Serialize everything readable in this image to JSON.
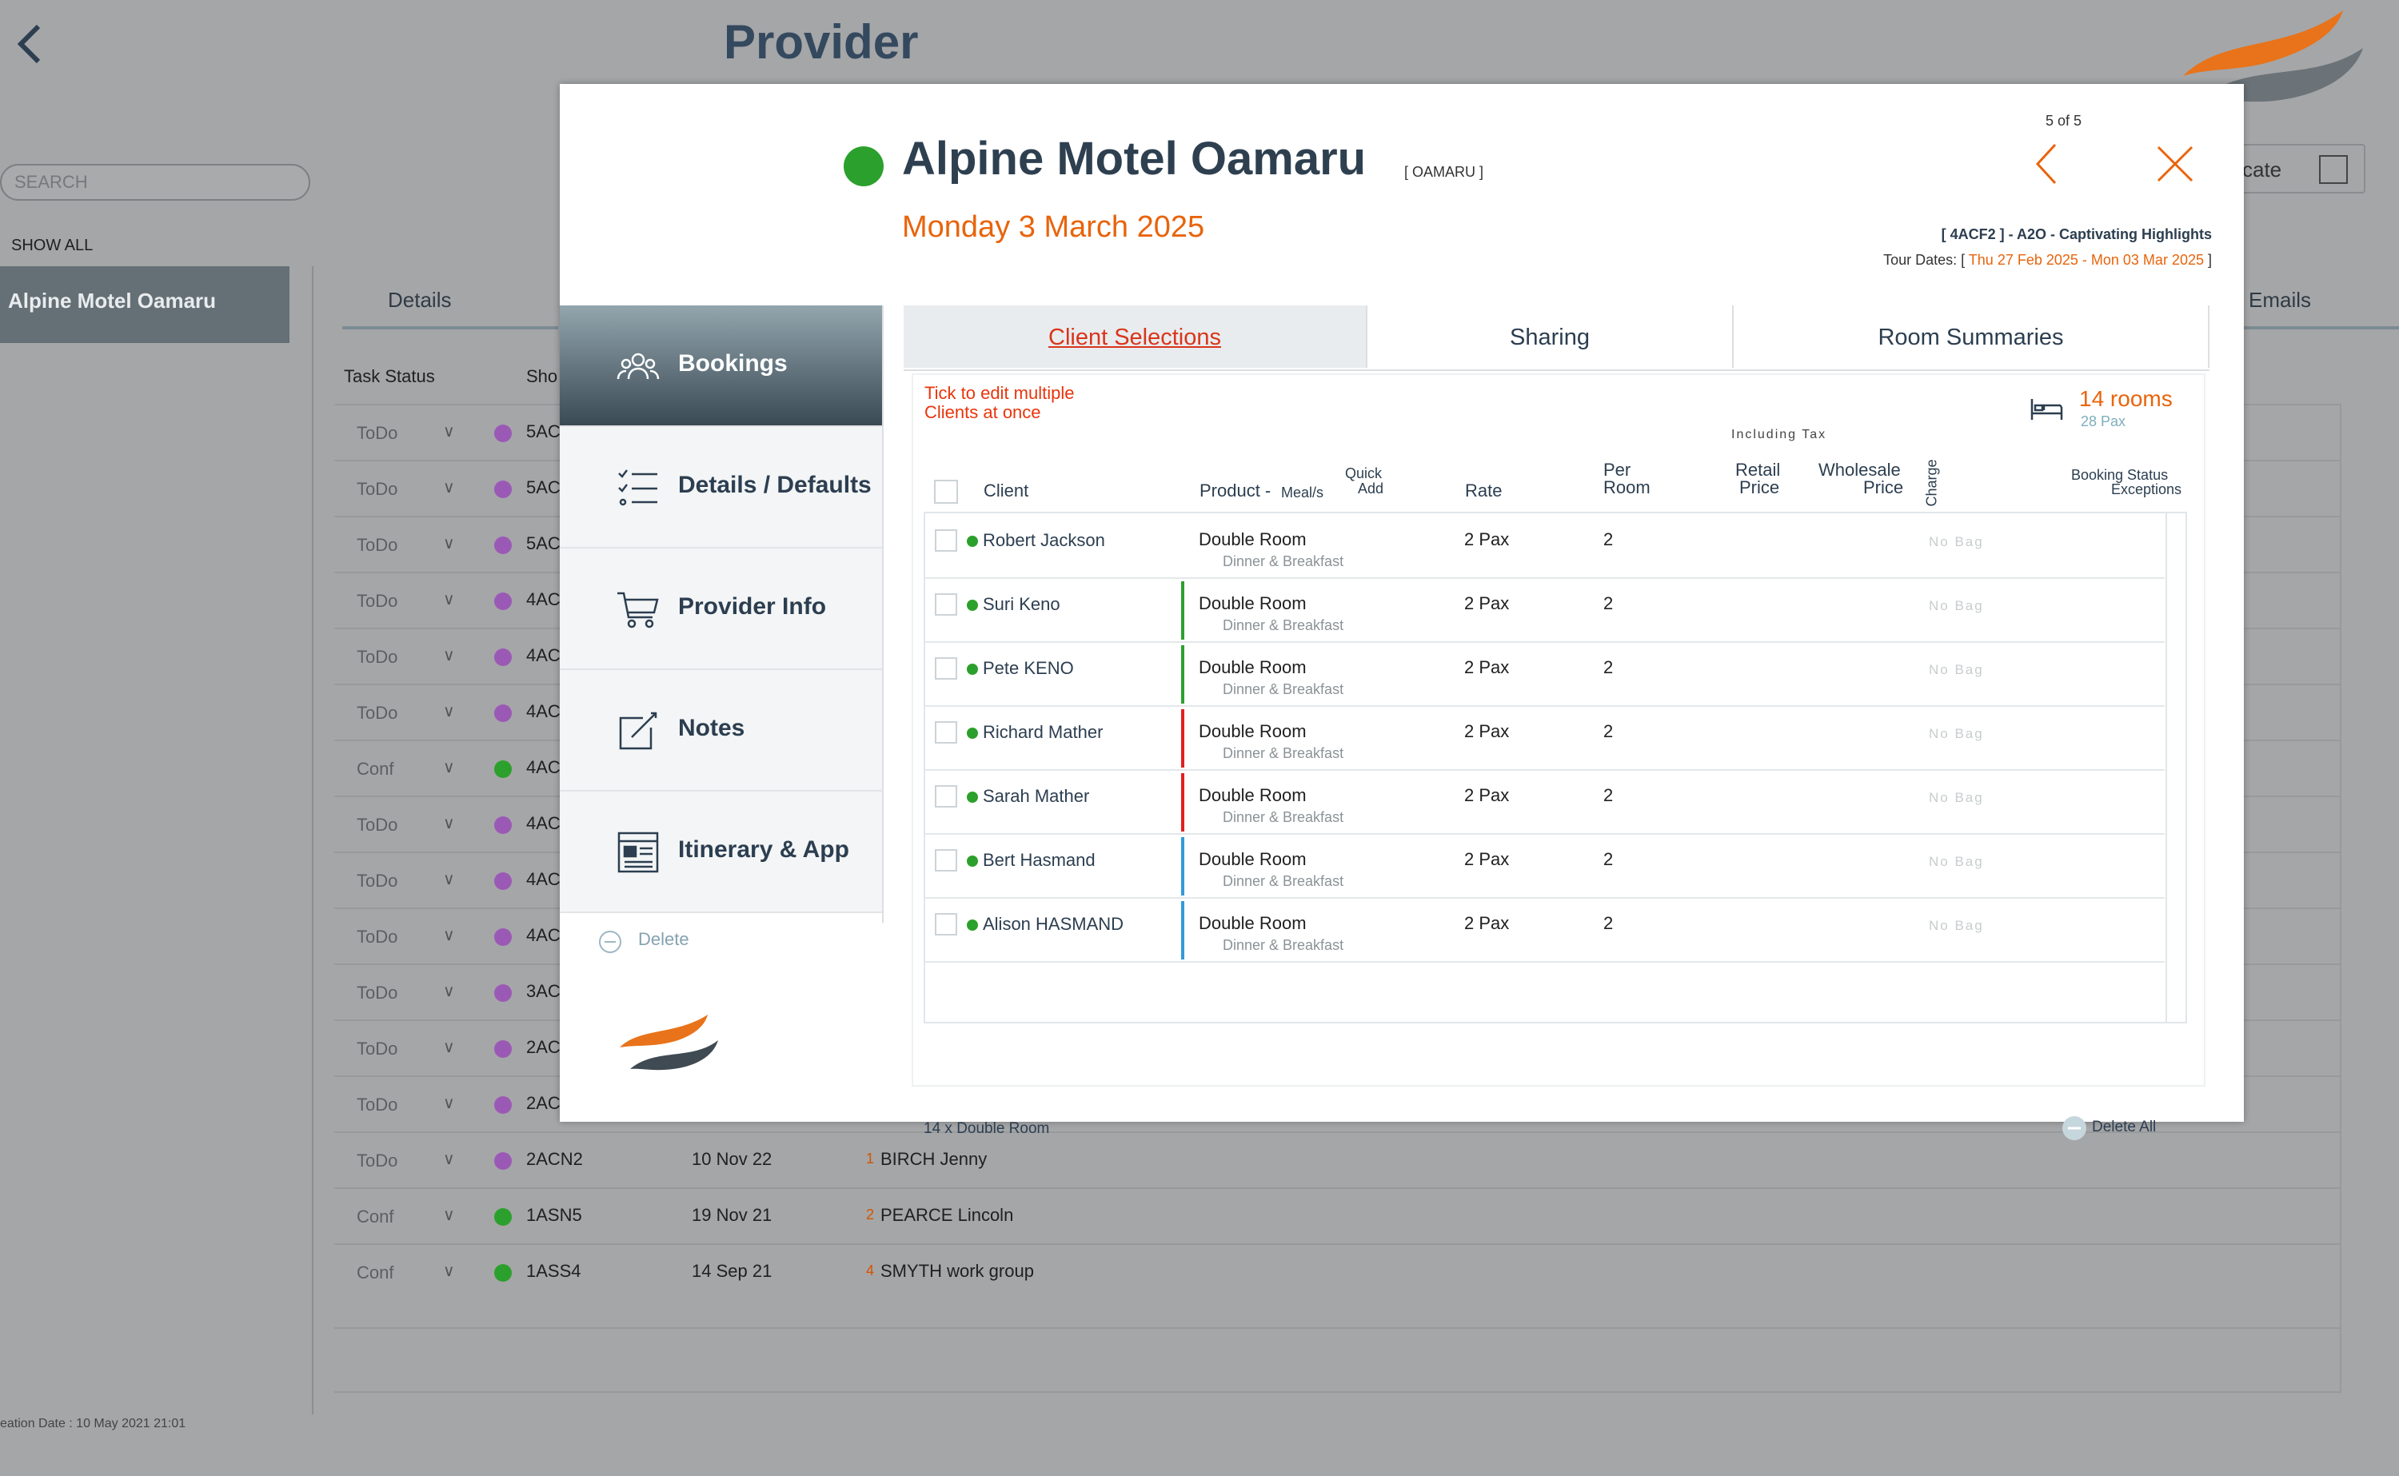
{
  "background": {
    "page_title": "Provider",
    "search_placeholder": "SEARCH",
    "show_all": "SHOW ALL",
    "selected_provider": "Alpine Motel Oamaru",
    "tab_details": "Details",
    "tab_emails": "Emails",
    "duplicate_partial": "cate",
    "col_task_status": "Task Status",
    "col_short": "Sho",
    "rows": [
      {
        "status": "ToDo",
        "color": "#9b59b6",
        "code": "5AC",
        "date": "",
        "num": "",
        "name": ""
      },
      {
        "status": "ToDo",
        "color": "#9b59b6",
        "code": "5AC",
        "date": "",
        "num": "",
        "name": ""
      },
      {
        "status": "ToDo",
        "color": "#9b59b6",
        "code": "5AC",
        "date": "",
        "num": "",
        "name": ""
      },
      {
        "status": "ToDo",
        "color": "#9b59b6",
        "code": "4AC",
        "date": "",
        "num": "",
        "name": ""
      },
      {
        "status": "ToDo",
        "color": "#9b59b6",
        "code": "4AC",
        "date": "",
        "num": "",
        "name": ""
      },
      {
        "status": "ToDo",
        "color": "#9b59b6",
        "code": "4AC",
        "date": "",
        "num": "",
        "name": ""
      },
      {
        "status": "Conf",
        "color": "#2ca02c",
        "code": "4AC",
        "date": "",
        "num": "",
        "name": ""
      },
      {
        "status": "ToDo",
        "color": "#9b59b6",
        "code": "4AC",
        "date": "",
        "num": "",
        "name": ""
      },
      {
        "status": "ToDo",
        "color": "#9b59b6",
        "code": "4AC",
        "date": "",
        "num": "",
        "name": ""
      },
      {
        "status": "ToDo",
        "color": "#9b59b6",
        "code": "4AC",
        "date": "",
        "num": "",
        "name": ""
      },
      {
        "status": "ToDo",
        "color": "#9b59b6",
        "code": "3AC",
        "date": "",
        "num": "",
        "name": ""
      },
      {
        "status": "ToDo",
        "color": "#9b59b6",
        "code": "2AC",
        "date": "",
        "num": "",
        "name": ""
      },
      {
        "status": "ToDo",
        "color": "#9b59b6",
        "code": "2AC",
        "date": "",
        "num": "",
        "name": ""
      },
      {
        "status": "ToDo",
        "color": "#9b59b6",
        "code": "2ACN2",
        "date": "10 Nov 22",
        "num": "1",
        "name": "BIRCH Jenny"
      },
      {
        "status": "Conf",
        "color": "#2ca02c",
        "code": "1ASN5",
        "date": "19 Nov 21",
        "num": "2",
        "name": "PEARCE Lincoln"
      },
      {
        "status": "Conf",
        "color": "#2ca02c",
        "code": "1ASS4",
        "date": "14 Sep 21",
        "num": "4",
        "name": "SMYTH work group"
      }
    ],
    "footer": "eation Date : 10 May 2021 21:01"
  },
  "modal": {
    "title": "Alpine Motel Oamaru",
    "location": "[ OAMARU ]",
    "date": "Monday 3 March 2025",
    "pager": "5 of 5",
    "tour_code": "[ 4ACF2 ] - A2O - Captivating Highlights",
    "tour_dates_label": "Tour Dates: [ ",
    "tour_dates_value": "Thu 27 Feb 2025 - Mon 03 Mar 2025",
    "tour_dates_close": " ]",
    "status_color": "#2ca02c",
    "nav": [
      {
        "label": "Bookings",
        "icon": "people-icon"
      },
      {
        "label": "Details / Defaults",
        "icon": "checklist-icon"
      },
      {
        "label": "Provider Info",
        "icon": "cart-icon"
      },
      {
        "label": "Notes",
        "icon": "edit-note-icon"
      },
      {
        "label": "Itinerary & App",
        "icon": "itinerary-icon"
      }
    ],
    "delete_label": "Delete",
    "tabs": [
      "Client Selections",
      "Sharing",
      "Room Summaries"
    ],
    "hint_line1": "Tick to edit multiple",
    "hint_line2": "Clients at once",
    "rooms": "14 rooms",
    "pax": "28 Pax",
    "including_tax": "Including Tax",
    "headers": {
      "client": "Client",
      "product": "Product -",
      "meals": "Meal/s",
      "quick": "Quick",
      "add": "Add",
      "rate": "Rate",
      "per": "Per",
      "room": "Room",
      "retail": "Retail",
      "retail_price": "Price",
      "wholesale": "Wholesale",
      "wholesale_price": "Price",
      "charge": "Charge",
      "booking_status": "Booking  Status",
      "exceptions": "Exceptions"
    },
    "rows": [
      {
        "client": "Robert Jackson",
        "product": "Double Room",
        "meal": "Dinner & Breakfast",
        "rate": "2 Pax",
        "per_room": "2",
        "bag": "No Bag",
        "group_color": ""
      },
      {
        "client": "Suri Keno",
        "product": "Double Room",
        "meal": "Dinner & Breakfast",
        "rate": "2 Pax",
        "per_room": "2",
        "bag": "No Bag",
        "group_color": "#2ca02c"
      },
      {
        "client": "Pete KENO",
        "product": "Double Room",
        "meal": "Dinner & Breakfast",
        "rate": "2 Pax",
        "per_room": "2",
        "bag": "No Bag",
        "group_color": "#2ca02c"
      },
      {
        "client": "Richard Mather",
        "product": "Double Room",
        "meal": "Dinner & Breakfast",
        "rate": "2 Pax",
        "per_room": "2",
        "bag": "No Bag",
        "group_color": "#e02020"
      },
      {
        "client": "Sarah Mather",
        "product": "Double Room",
        "meal": "Dinner & Breakfast",
        "rate": "2 Pax",
        "per_room": "2",
        "bag": "No Bag",
        "group_color": "#e02020"
      },
      {
        "client": "Bert Hasmand",
        "product": "Double Room",
        "meal": "Dinner & Breakfast",
        "rate": "2 Pax",
        "per_room": "2",
        "bag": "No Bag",
        "group_color": "#3498db"
      },
      {
        "client": "Alison HASMAND",
        "product": "Double Room",
        "meal": "Dinner & Breakfast",
        "rate": "2 Pax",
        "per_room": "2",
        "bag": "No Bag",
        "group_color": "#3498db"
      }
    ],
    "summary": "14 x Double Room",
    "delete_all": "Delete All"
  }
}
